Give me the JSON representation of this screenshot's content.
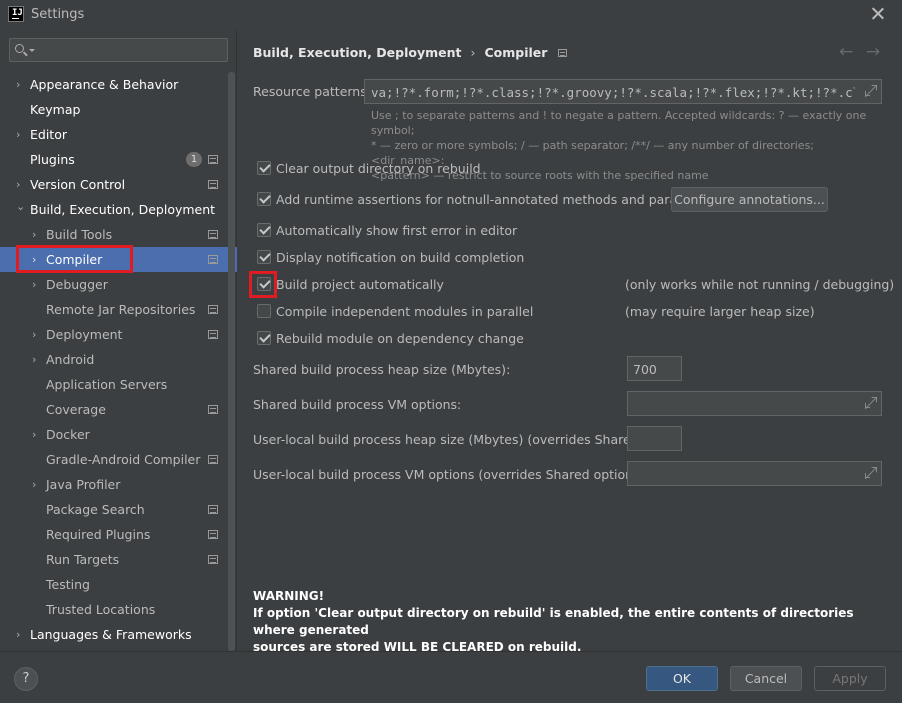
{
  "window": {
    "title": "Settings"
  },
  "search": {
    "placeholder": ""
  },
  "sidebar": {
    "items": [
      {
        "label": "Appearance & Behavior",
        "arrow": "›"
      },
      {
        "label": "Keymap",
        "arrow": ""
      },
      {
        "label": "Editor",
        "arrow": "›"
      },
      {
        "label": "Plugins",
        "arrow": "",
        "badge": "1"
      },
      {
        "label": "Version Control",
        "arrow": "›"
      },
      {
        "label": "Build, Execution, Deployment",
        "arrow": "⌄"
      },
      {
        "label": "Build Tools",
        "arrow": "›"
      },
      {
        "label": "Compiler",
        "arrow": "›"
      },
      {
        "label": "Debugger",
        "arrow": "›"
      },
      {
        "label": "Remote Jar Repositories",
        "arrow": ""
      },
      {
        "label": "Deployment",
        "arrow": "›"
      },
      {
        "label": "Android",
        "arrow": "›"
      },
      {
        "label": "Application Servers",
        "arrow": ""
      },
      {
        "label": "Coverage",
        "arrow": ""
      },
      {
        "label": "Docker",
        "arrow": "›"
      },
      {
        "label": "Gradle-Android Compiler",
        "arrow": ""
      },
      {
        "label": "Java Profiler",
        "arrow": "›"
      },
      {
        "label": "Package Search",
        "arrow": ""
      },
      {
        "label": "Required Plugins",
        "arrow": ""
      },
      {
        "label": "Run Targets",
        "arrow": ""
      },
      {
        "label": "Testing",
        "arrow": ""
      },
      {
        "label": "Trusted Locations",
        "arrow": ""
      },
      {
        "label": "Languages & Frameworks",
        "arrow": "›"
      }
    ]
  },
  "breadcrumb": {
    "parent": "Build, Execution, Deployment",
    "current": "Compiler",
    "separator": "›"
  },
  "nav": {
    "back": "←",
    "forward": "→"
  },
  "resource_patterns": {
    "label": "Resource patterns:",
    "value": "va;!?*.form;!?*.class;!?*.groovy;!?*.scala;!?*.flex;!?*.kt;!?*.clj;!?",
    "hint_line1": "Use ; to separate patterns and ! to negate a pattern. Accepted wildcards: ? — exactly one symbol;",
    "hint_line2": "* — zero or more symbols; / — path separator; /**/ — any number of directories; <dir_name>:",
    "hint_line3": "<pattern> — restrict to source roots with the specified name"
  },
  "options": {
    "clear_output": {
      "label": "Clear output directory on rebuild",
      "checked": true
    },
    "runtime_assertions": {
      "label": "Add runtime assertions for notnull-annotated methods and parameters",
      "checked": true
    },
    "configure_annotations": "Configure annotations...",
    "show_first_error": {
      "label": "Automatically show first error in editor",
      "checked": true
    },
    "display_notification": {
      "label": "Display notification on build completion",
      "checked": true
    },
    "build_automatically": {
      "label": "Build project automatically",
      "checked": true,
      "note": "(only works while not running / debugging)"
    },
    "compile_parallel": {
      "label": "Compile independent modules in parallel",
      "checked": false,
      "note": "(may require larger heap size)"
    },
    "rebuild_on_dependency": {
      "label": "Rebuild module on dependency change",
      "checked": true
    }
  },
  "fields": {
    "shared_heap": {
      "label": "Shared build process heap size (Mbytes):",
      "value": "700"
    },
    "shared_vm": {
      "label": "Shared build process VM options:",
      "value": ""
    },
    "local_heap": {
      "label": "User-local build process heap size (Mbytes) (overrides Shared size):",
      "value": ""
    },
    "local_vm": {
      "label": "User-local build process VM options (overrides Shared options):",
      "value": ""
    }
  },
  "warning": {
    "title": "WARNING!",
    "line1": "If option 'Clear output directory on rebuild' is enabled, the entire contents of directories where generated",
    "line2": "sources are stored WILL BE CLEARED on rebuild."
  },
  "footer": {
    "help": "?",
    "ok": "OK",
    "cancel": "Cancel",
    "apply": "Apply"
  }
}
